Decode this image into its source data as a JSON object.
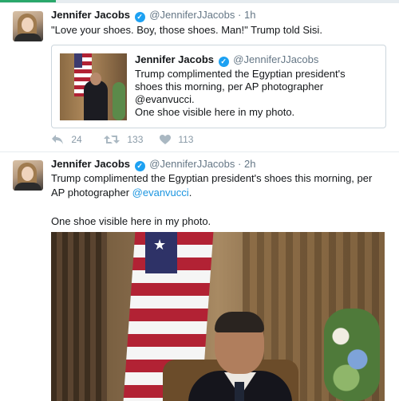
{
  "tweets": [
    {
      "author": {
        "name": "Jennifer Jacobs",
        "handle": "@JenniferJJacobs",
        "verified": true
      },
      "time": "1h",
      "text": "\"Love your shoes. Boy, those shoes. Man!\" Trump told Sisi.",
      "quoted": {
        "author": {
          "name": "Jennifer Jacobs",
          "handle": "@JenniferJJacobs",
          "verified": true
        },
        "text": "Trump complimented the Egyptian president's shoes this morning, per AP photographer @evanvucci.",
        "text2": "One shoe visible here in my photo."
      },
      "actions": {
        "replies": "24",
        "retweets": "133",
        "likes": "113"
      }
    },
    {
      "author": {
        "name": "Jennifer Jacobs",
        "handle": "@JenniferJJacobs",
        "verified": true
      },
      "time": "2h",
      "text_main": "Trump complimented the Egyptian president's shoes this morning, per AP photographer ",
      "text_link": "@evanvucci",
      "text_end": ".",
      "text2": "One shoe visible here in my photo."
    }
  ],
  "separator": "·",
  "icons": {
    "verified": "verified-badge-icon",
    "reply": "reply-icon",
    "retweet": "retweet-icon",
    "like": "heart-icon"
  },
  "colors": {
    "verified": "#1da1f2",
    "link": "#1b95e0",
    "muted": "#657786",
    "action": "#aab8c2",
    "accent_strip": "#2aa86b"
  }
}
